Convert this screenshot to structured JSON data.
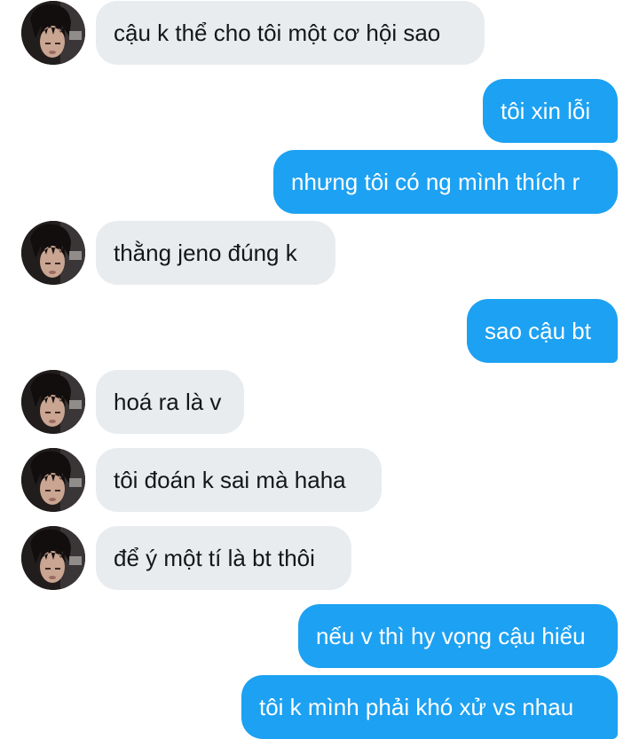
{
  "conversation": {
    "messages": [
      {
        "from": "them",
        "text": "cậu k thể cho tôi một cơ hội sao"
      },
      {
        "from": "me",
        "text": "tôi xin lỗi"
      },
      {
        "from": "me",
        "text": "nhưng tôi có ng mình thích r"
      },
      {
        "from": "them",
        "text": "thằng jeno đúng k"
      },
      {
        "from": "me",
        "text": "sao cậu bt"
      },
      {
        "from": "them",
        "text": "hoá ra là v"
      },
      {
        "from": "them",
        "text": "tôi đoán k sai mà haha"
      },
      {
        "from": "them",
        "text": "để ý một tí là bt thôi"
      },
      {
        "from": "me",
        "text": "nếu v thì hy vọng cậu hiểu"
      },
      {
        "from": "me",
        "text": "tôi k mình phải khó xử vs nhau"
      }
    ]
  },
  "colors": {
    "incoming_bubble": "#e9ecef",
    "outgoing_bubble": "#1da1f2",
    "incoming_text": "#14171a",
    "outgoing_text": "#ffffff"
  },
  "icons": {
    "avatar": "contact-avatar-photo"
  }
}
